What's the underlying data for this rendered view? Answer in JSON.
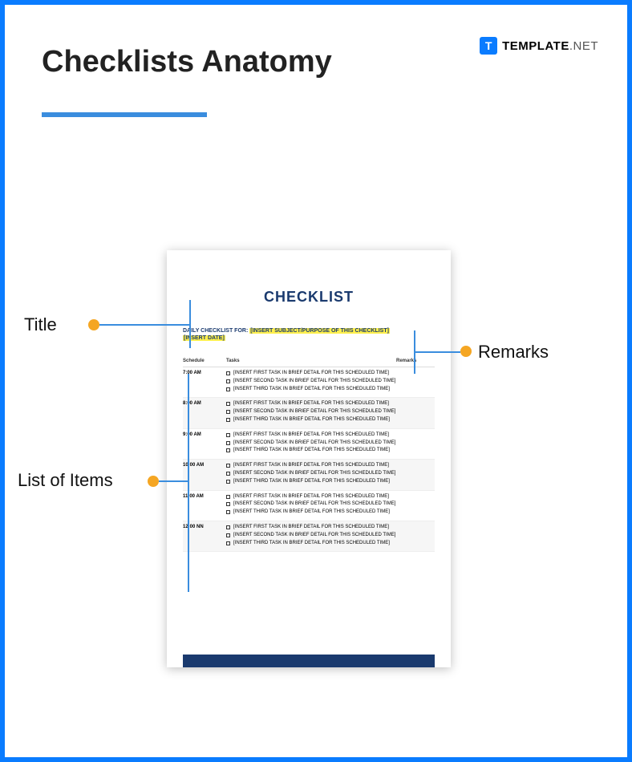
{
  "logo": {
    "icon_letter": "T",
    "text_bold": "TEMPLATE",
    "text_light": ".NET"
  },
  "page_title": "Checklists Anatomy",
  "annotations": {
    "title": "Title",
    "remarks": "Remarks",
    "list": "List of Items"
  },
  "doc": {
    "title": "CHECKLIST",
    "subtitle_prefix": "DAILY CHECKLIST FOR:",
    "subtitle_hl": "[INSERT SUBJECT/PURPOSE OF THIS CHECKLIST]",
    "date_hl": "[INSERT DATE]",
    "headers": {
      "schedule": "Schedule",
      "tasks": "Tasks",
      "remarks": "Remarks"
    },
    "rows": [
      {
        "time": "7:00 AM",
        "tasks": [
          "[INSERT FIRST TASK IN BRIEF DETAIL FOR THIS SCHEDULED TIME]",
          "[INSERT SECOND TASK IN BRIEF DETAIL FOR THIS SCHEDULED TIME]",
          "[INSERT THIRD TASK IN BRIEF DETAIL FOR THIS SCHEDULED TIME]"
        ]
      },
      {
        "time": "8:00 AM",
        "tasks": [
          "[INSERT FIRST TASK IN BRIEF DETAIL FOR THIS SCHEDULED TIME]",
          "[INSERT SECOND TASK IN BRIEF DETAIL FOR THIS SCHEDULED TIME]",
          "[INSERT THIRD TASK IN BRIEF DETAIL FOR THIS SCHEDULED TIME]"
        ]
      },
      {
        "time": "9:00 AM",
        "tasks": [
          "[INSERT FIRST TASK IN BRIEF DETAIL FOR THIS SCHEDULED TIME]",
          "[INSERT SECOND TASK IN BRIEF DETAIL FOR THIS SCHEDULED TIME]",
          "[INSERT THIRD TASK IN BRIEF DETAIL FOR THIS SCHEDULED TIME]"
        ]
      },
      {
        "time": "10:00 AM",
        "tasks": [
          "[INSERT FIRST TASK IN BRIEF DETAIL FOR THIS SCHEDULED TIME]",
          "[INSERT SECOND TASK IN BRIEF DETAIL FOR THIS SCHEDULED TIME]",
          "[INSERT THIRD TASK IN BRIEF DETAIL FOR THIS SCHEDULED TIME]"
        ]
      },
      {
        "time": "11:00 AM",
        "tasks": [
          "[INSERT FIRST TASK IN BRIEF DETAIL FOR THIS SCHEDULED TIME]",
          "[INSERT SECOND TASK IN BRIEF DETAIL FOR THIS SCHEDULED TIME]",
          "[INSERT THIRD TASK IN BRIEF DETAIL FOR THIS SCHEDULED TIME]"
        ]
      },
      {
        "time": "12:00 NN",
        "tasks": [
          "[INSERT FIRST TASK IN BRIEF DETAIL FOR THIS SCHEDULED TIME]",
          "[INSERT SECOND TASK IN BRIEF DETAIL FOR THIS SCHEDULED TIME]",
          "[INSERT THIRD TASK IN BRIEF DETAIL FOR THIS SCHEDULED TIME]"
        ]
      }
    ]
  }
}
